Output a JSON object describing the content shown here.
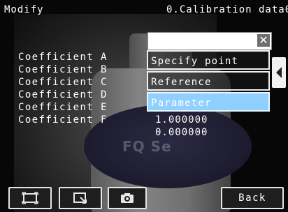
{
  "header": {
    "title_left": "Modify",
    "title_right": "0.Calibration data0"
  },
  "coefficients": {
    "labels": [
      "Coefficient A",
      "Coefficient B",
      "Coefficient C",
      "Coefficient D",
      "Coefficient E",
      "Coefficient F"
    ],
    "visible_values": {
      "E": "1.000000",
      "F": "0.000000"
    }
  },
  "background_image": {
    "label_text": "FQ Se"
  },
  "menu": {
    "close_symbol": "✕",
    "items": [
      {
        "label": "Specify point",
        "selected": false
      },
      {
        "label": "Reference",
        "selected": false
      },
      {
        "label": "Parameter",
        "selected": true
      }
    ]
  },
  "bottom_bar": {
    "back_label": "Back",
    "icons": [
      "frame-icon",
      "zoom-window-icon",
      "camera-icon"
    ]
  },
  "colors": {
    "selected_item": "#8fd0ff",
    "button_border": "#e6e6e6"
  }
}
